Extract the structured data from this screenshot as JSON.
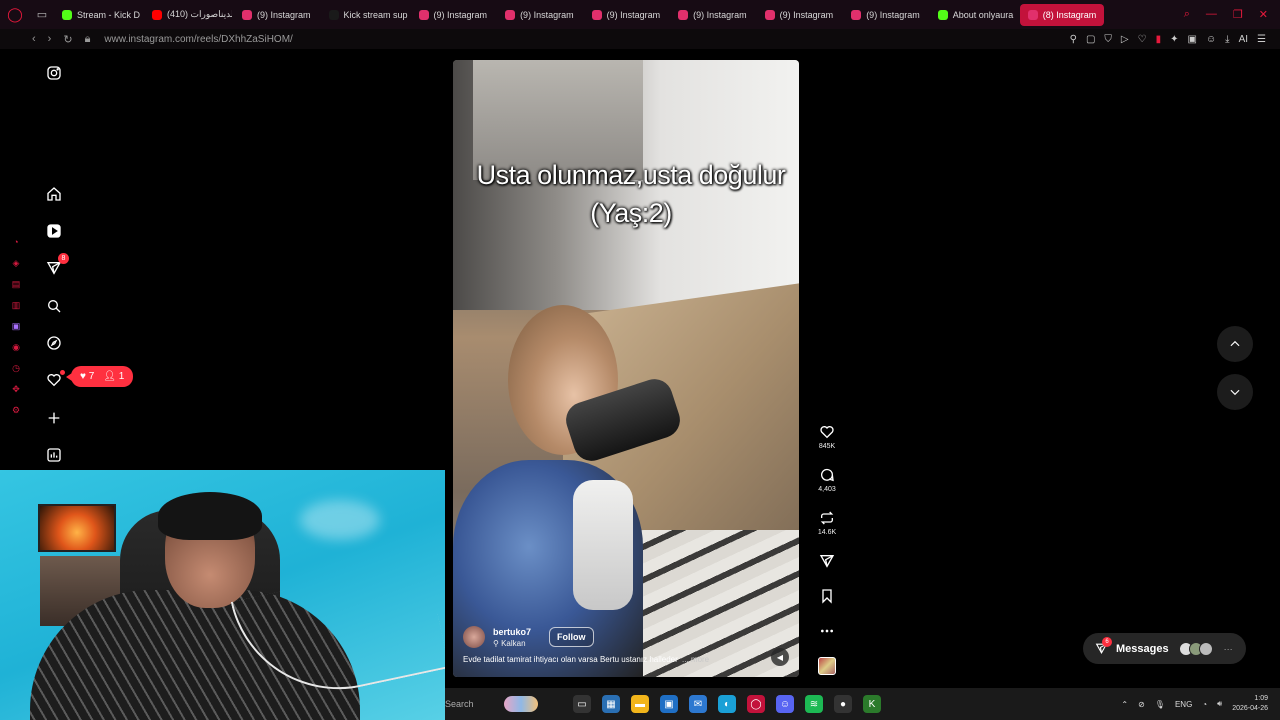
{
  "browser": {
    "tabs": [
      {
        "label": "Stream - Kick D",
        "color": "#53fc18"
      },
      {
        "label": "(410) الديناصورات",
        "color": "#ff0000"
      },
      {
        "label": "(9) Instagram",
        "color": "#e1306c"
      },
      {
        "label": "Kick stream sup",
        "color": "#1a1a1a"
      },
      {
        "label": "(9) Instagram",
        "color": "#e1306c"
      },
      {
        "label": "(9) Instagram",
        "color": "#e1306c"
      },
      {
        "label": "(9) Instagram",
        "color": "#e1306c"
      },
      {
        "label": "(9) Instagram",
        "color": "#e1306c"
      },
      {
        "label": "(9) Instagram",
        "color": "#e1306c"
      },
      {
        "label": "(9) Instagram",
        "color": "#e1306c"
      },
      {
        "label": "About onlyaura",
        "color": "#53fc18"
      },
      {
        "label": "(8) Instagram",
        "color": "#e1306c",
        "active": true
      }
    ],
    "url": "www.instagram.com/reels/DXhhZaSiHOM/",
    "tools_label": "AI"
  },
  "instagram": {
    "nav": {
      "notifications_badge": "8",
      "likes_count": "7",
      "followers_count": "1"
    },
    "reel": {
      "overlay_line1": "Usta olunmaz,usta doğulur",
      "overlay_line2": "(Yaş:2)",
      "author": "bertuko7",
      "location": "Kalkan",
      "follow_label": "Follow",
      "description": "Evde tadilat tamirat ihtiyacı olan varsa Bertu ustanız halleder",
      "more_label": "... more"
    },
    "actions": {
      "likes": "845K",
      "comments": "4,403",
      "reposts": "14.6K"
    },
    "messages": {
      "label": "Messages",
      "badge": "6"
    }
  },
  "taskbar": {
    "search_placeholder": "Search",
    "language": "ENG",
    "time": "1:09",
    "date": "2026-04-26"
  },
  "colors": {
    "accent": "#ff3040",
    "browser_accent": "#e6193c",
    "active_tab": "#c3123b"
  }
}
